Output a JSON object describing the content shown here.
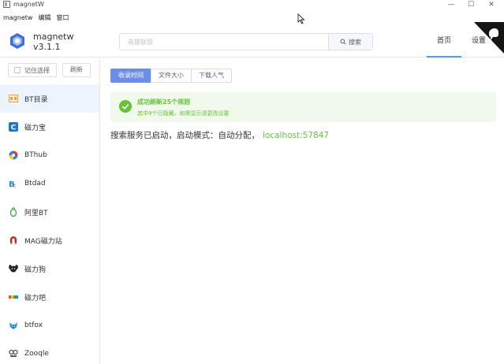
{
  "window": {
    "title": "magnetW",
    "controls": [
      "—",
      "☐",
      "✕"
    ]
  },
  "menubar": {
    "items": [
      "magnetw",
      "编辑",
      "窗口"
    ]
  },
  "header": {
    "brand_name": "magnetw",
    "version": "v3.1.1",
    "search_placeholder": "英雄联盟",
    "search_button": "搜索",
    "nav": [
      {
        "label": "首页",
        "active": true
      },
      {
        "label": "设置",
        "active": false
      }
    ]
  },
  "sidebar": {
    "remember_label": "记住选择",
    "remember_checked": false,
    "refresh_label": "刷新",
    "sites": [
      {
        "label": "BT目录",
        "icon": "bt-directory-icon",
        "active": true,
        "color": "#e6a23c"
      },
      {
        "label": "磁力宝",
        "icon": "cilibao-icon",
        "active": false,
        "color": "#1976d2"
      },
      {
        "label": "BThub",
        "icon": "bthub-icon",
        "active": false,
        "color": "#e53935"
      },
      {
        "label": "Btdad",
        "icon": "btdad-icon",
        "active": false,
        "color": "#1e88e5"
      },
      {
        "label": "阿里BT",
        "icon": "alibt-icon",
        "active": false,
        "color": "#43a047"
      },
      {
        "label": "MAG磁力站",
        "icon": "magnet-icon",
        "active": false,
        "color": "#c62828"
      },
      {
        "label": "磁力狗",
        "icon": "dog-icon",
        "active": false,
        "color": "#222222"
      },
      {
        "label": "磁力吧",
        "icon": "ciliba-icon",
        "active": false,
        "color": "#f4511e"
      },
      {
        "label": "btfox",
        "icon": "fox-icon",
        "active": false,
        "color": "#1e88e5"
      },
      {
        "label": "Zooqle",
        "icon": "zooqle-icon",
        "active": false,
        "color": "#555555"
      }
    ]
  },
  "sort": {
    "options": [
      {
        "label": "收录时间",
        "active": true
      },
      {
        "label": "文件大小",
        "active": false
      },
      {
        "label": "下载人气",
        "active": false
      }
    ]
  },
  "alert": {
    "title": "成功刷新25个规则",
    "description": "其中9个已隐藏，如需显示请更改设置"
  },
  "status": {
    "text": "搜索服务已启动，启动模式：自动分配，",
    "url": "localhost:57847"
  },
  "colors": {
    "accent": "#409eff",
    "sort_active": "#6c8ee8",
    "success": "#67c23a",
    "success_bg": "#f0f9eb"
  }
}
